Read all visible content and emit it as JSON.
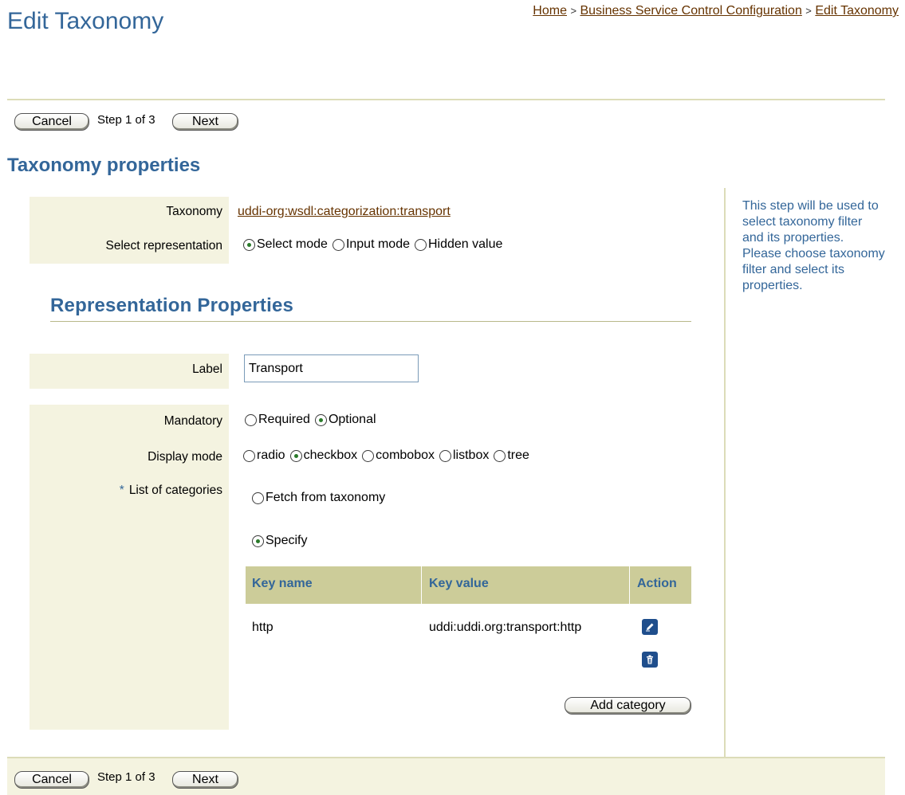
{
  "header": {
    "title": "Edit Taxonomy",
    "breadcrumb": [
      {
        "label": "Home"
      },
      {
        "label": "Business Service Control Configuration"
      },
      {
        "label": "Edit Taxonomy"
      }
    ],
    "breadcrumb_separator": ">"
  },
  "nav_top": {
    "cancel_label": "Cancel",
    "step_text": "Step 1 of 3",
    "next_label": "Next"
  },
  "taxonomy_properties": {
    "section_title": "Taxonomy properties",
    "taxonomy_label": "Taxonomy",
    "taxonomy_value": "uddi-org:wsdl:categorization:transport",
    "select_representation_label": "Select representation",
    "representation_options": [
      "Select mode",
      "Input mode",
      "Hidden value"
    ],
    "representation_selected": "Select mode"
  },
  "representation_properties": {
    "section_title": "Representation Properties",
    "label_label": "Label",
    "label_value": "Transport",
    "mandatory_label": "Mandatory",
    "mandatory_options": [
      "Required",
      "Optional"
    ],
    "mandatory_selected": "Optional",
    "display_mode_label": "Display mode",
    "display_mode_options": [
      "radio",
      "checkbox",
      "combobox",
      "listbox",
      "tree"
    ],
    "display_mode_selected": "checkbox",
    "list_of_categories_label": "List of categories",
    "required_marker": "*",
    "list_options": [
      "Fetch from taxonomy",
      "Specify"
    ],
    "list_selected": "Specify",
    "table": {
      "columns": [
        "Key name",
        "Key value",
        "Action"
      ],
      "rows": [
        {
          "key_name": "http",
          "key_value": "uddi:uddi.org:transport:http",
          "actions": [
            "edit-icon",
            "delete-icon"
          ]
        }
      ]
    },
    "add_category_label": "Add category"
  },
  "help": {
    "text": "This step will be used to select taxonomy filter and its properties. Please choose taxonomy filter and select its properties."
  },
  "nav_bottom": {
    "cancel_label": "Cancel",
    "step_text": "Step 1 of 3",
    "next_label": "Next"
  },
  "colors": {
    "title": "#336699",
    "link": "#663300",
    "label_background": "#f4f3e0",
    "table_header": "#cccc99",
    "icon_button": "#1f4e8c"
  }
}
